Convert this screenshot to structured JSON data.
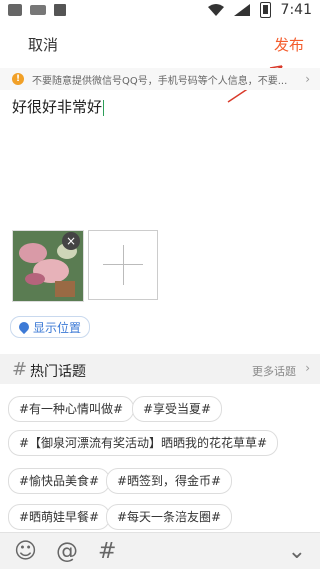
{
  "status": {
    "time": "7:41"
  },
  "header": {
    "cancel": "取消",
    "publish": "发布"
  },
  "notice": {
    "text": "不要随意提供微信号QQ号，手机号码等个人信息，不要..."
  },
  "post": {
    "text": "好很好非常好"
  },
  "location": {
    "label": "显示位置"
  },
  "hot": {
    "title": "热门话题",
    "more": "更多话题"
  },
  "topics": [
    "#有一种心情叫做#",
    "#享受当夏#",
    "#【御泉河漂流有奖活动】晒晒我的花花草草#",
    "#愉快品美食#",
    "#晒签到，得金币#",
    "#晒萌娃早餐#",
    "#每天一条涪友圈#"
  ],
  "icons": [
    "emoji-icon",
    "at-icon",
    "hash-icon",
    "collapse-icon"
  ],
  "colors": {
    "accent": "#f45c2c",
    "location": "#3c7ad6"
  }
}
